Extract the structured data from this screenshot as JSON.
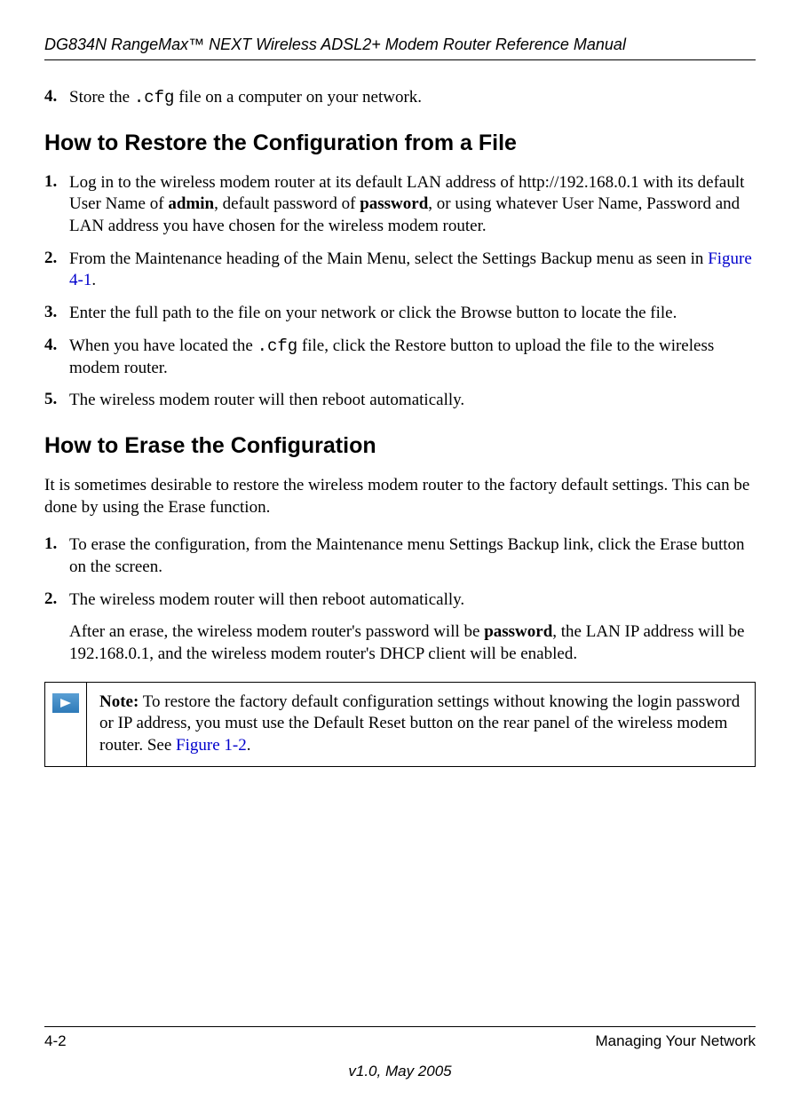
{
  "header": {
    "title": "DG834N RangeMax™ NEXT Wireless ADSL2+ Modem Router Reference Manual"
  },
  "step4_top": {
    "number": "4.",
    "text_before": "Store the ",
    "code": ".cfg",
    "text_after": " file on a computer on your network."
  },
  "heading_restore": "How to Restore the Configuration from a File",
  "restore_steps": [
    {
      "number": "1.",
      "parts": [
        {
          "text": "Log in to the wireless modem router at its default LAN address of http://192.168.0.1 with its default User Name of "
        },
        {
          "text": "admin",
          "bold": true
        },
        {
          "text": ", default password of "
        },
        {
          "text": "password",
          "bold": true
        },
        {
          "text": ", or using whatever User Name, Password and LAN address you have chosen for the wireless modem router."
        }
      ]
    },
    {
      "number": "2.",
      "parts": [
        {
          "text": "From the Maintenance heading of the Main Menu, select the Settings Backup menu as seen in "
        },
        {
          "text": "Figure 4-1",
          "link": true
        },
        {
          "text": "."
        }
      ]
    },
    {
      "number": "3.",
      "parts": [
        {
          "text": "Enter the full path to the file on your network or click the Browse button to locate the file."
        }
      ]
    },
    {
      "number": "4.",
      "parts": [
        {
          "text": "When you have located the "
        },
        {
          "text": ".cfg",
          "mono": true
        },
        {
          "text": " file, click the Restore button to upload the file to the wireless modem router."
        }
      ]
    },
    {
      "number": "5.",
      "parts": [
        {
          "text": "The wireless modem router will then reboot automatically."
        }
      ]
    }
  ],
  "heading_erase": "How to Erase the Configuration",
  "erase_intro": "It is sometimes desirable to restore the wireless modem router to the factory default settings. This can be done by using the Erase function.",
  "erase_steps": [
    {
      "number": "1.",
      "text": "To erase the configuration, from the Maintenance menu Settings Backup link, click the Erase button on the screen."
    },
    {
      "number": "2.",
      "text": "The wireless modem router will then reboot automatically."
    }
  ],
  "erase_result_parts": [
    {
      "text": "After an erase, the wireless modem router's password will be "
    },
    {
      "text": "password",
      "bold": true
    },
    {
      "text": ", the LAN IP address will be 192.168.0.1, and the wireless modem router's DHCP client will be enabled."
    }
  ],
  "note": {
    "label": "Note:",
    "text_before": " To restore the factory default configuration settings without knowing the login password or IP address, you must use the Default Reset button on the rear panel of the wireless modem router. See ",
    "link": "Figure 1-2",
    "text_after": "."
  },
  "footer": {
    "page": "4-2",
    "section": "Managing Your Network",
    "version": "v1.0, May 2005"
  }
}
